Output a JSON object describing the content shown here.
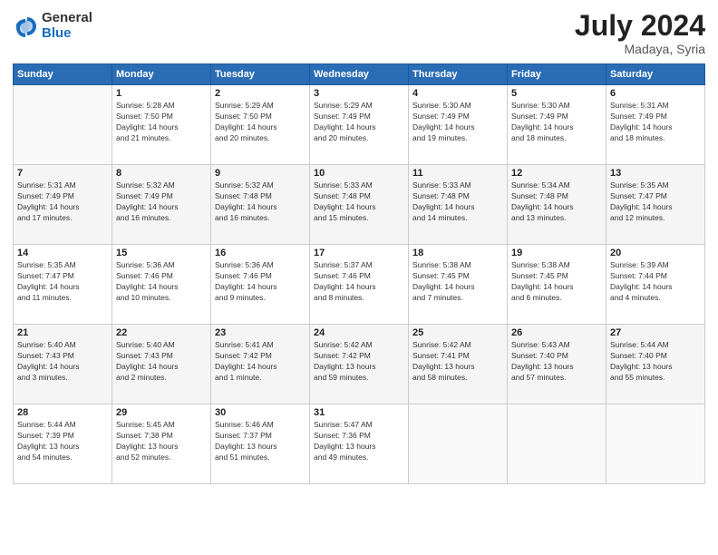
{
  "header": {
    "logo_general": "General",
    "logo_blue": "Blue",
    "month_year": "July 2024",
    "location": "Madaya, Syria"
  },
  "calendar": {
    "columns": [
      "Sunday",
      "Monday",
      "Tuesday",
      "Wednesday",
      "Thursday",
      "Friday",
      "Saturday"
    ],
    "rows": [
      [
        {
          "day": "",
          "info": ""
        },
        {
          "day": "1",
          "info": "Sunrise: 5:28 AM\nSunset: 7:50 PM\nDaylight: 14 hours\nand 21 minutes."
        },
        {
          "day": "2",
          "info": "Sunrise: 5:29 AM\nSunset: 7:50 PM\nDaylight: 14 hours\nand 20 minutes."
        },
        {
          "day": "3",
          "info": "Sunrise: 5:29 AM\nSunset: 7:49 PM\nDaylight: 14 hours\nand 20 minutes."
        },
        {
          "day": "4",
          "info": "Sunrise: 5:30 AM\nSunset: 7:49 PM\nDaylight: 14 hours\nand 19 minutes."
        },
        {
          "day": "5",
          "info": "Sunrise: 5:30 AM\nSunset: 7:49 PM\nDaylight: 14 hours\nand 18 minutes."
        },
        {
          "day": "6",
          "info": "Sunrise: 5:31 AM\nSunset: 7:49 PM\nDaylight: 14 hours\nand 18 minutes."
        }
      ],
      [
        {
          "day": "7",
          "info": "Sunrise: 5:31 AM\nSunset: 7:49 PM\nDaylight: 14 hours\nand 17 minutes."
        },
        {
          "day": "8",
          "info": "Sunrise: 5:32 AM\nSunset: 7:49 PM\nDaylight: 14 hours\nand 16 minutes."
        },
        {
          "day": "9",
          "info": "Sunrise: 5:32 AM\nSunset: 7:48 PM\nDaylight: 14 hours\nand 16 minutes."
        },
        {
          "day": "10",
          "info": "Sunrise: 5:33 AM\nSunset: 7:48 PM\nDaylight: 14 hours\nand 15 minutes."
        },
        {
          "day": "11",
          "info": "Sunrise: 5:33 AM\nSunset: 7:48 PM\nDaylight: 14 hours\nand 14 minutes."
        },
        {
          "day": "12",
          "info": "Sunrise: 5:34 AM\nSunset: 7:48 PM\nDaylight: 14 hours\nand 13 minutes."
        },
        {
          "day": "13",
          "info": "Sunrise: 5:35 AM\nSunset: 7:47 PM\nDaylight: 14 hours\nand 12 minutes."
        }
      ],
      [
        {
          "day": "14",
          "info": "Sunrise: 5:35 AM\nSunset: 7:47 PM\nDaylight: 14 hours\nand 11 minutes."
        },
        {
          "day": "15",
          "info": "Sunrise: 5:36 AM\nSunset: 7:46 PM\nDaylight: 14 hours\nand 10 minutes."
        },
        {
          "day": "16",
          "info": "Sunrise: 5:36 AM\nSunset: 7:46 PM\nDaylight: 14 hours\nand 9 minutes."
        },
        {
          "day": "17",
          "info": "Sunrise: 5:37 AM\nSunset: 7:46 PM\nDaylight: 14 hours\nand 8 minutes."
        },
        {
          "day": "18",
          "info": "Sunrise: 5:38 AM\nSunset: 7:45 PM\nDaylight: 14 hours\nand 7 minutes."
        },
        {
          "day": "19",
          "info": "Sunrise: 5:38 AM\nSunset: 7:45 PM\nDaylight: 14 hours\nand 6 minutes."
        },
        {
          "day": "20",
          "info": "Sunrise: 5:39 AM\nSunset: 7:44 PM\nDaylight: 14 hours\nand 4 minutes."
        }
      ],
      [
        {
          "day": "21",
          "info": "Sunrise: 5:40 AM\nSunset: 7:43 PM\nDaylight: 14 hours\nand 3 minutes."
        },
        {
          "day": "22",
          "info": "Sunrise: 5:40 AM\nSunset: 7:43 PM\nDaylight: 14 hours\nand 2 minutes."
        },
        {
          "day": "23",
          "info": "Sunrise: 5:41 AM\nSunset: 7:42 PM\nDaylight: 14 hours\nand 1 minute."
        },
        {
          "day": "24",
          "info": "Sunrise: 5:42 AM\nSunset: 7:42 PM\nDaylight: 13 hours\nand 59 minutes."
        },
        {
          "day": "25",
          "info": "Sunrise: 5:42 AM\nSunset: 7:41 PM\nDaylight: 13 hours\nand 58 minutes."
        },
        {
          "day": "26",
          "info": "Sunrise: 5:43 AM\nSunset: 7:40 PM\nDaylight: 13 hours\nand 57 minutes."
        },
        {
          "day": "27",
          "info": "Sunrise: 5:44 AM\nSunset: 7:40 PM\nDaylight: 13 hours\nand 55 minutes."
        }
      ],
      [
        {
          "day": "28",
          "info": "Sunrise: 5:44 AM\nSunset: 7:39 PM\nDaylight: 13 hours\nand 54 minutes."
        },
        {
          "day": "29",
          "info": "Sunrise: 5:45 AM\nSunset: 7:38 PM\nDaylight: 13 hours\nand 52 minutes."
        },
        {
          "day": "30",
          "info": "Sunrise: 5:46 AM\nSunset: 7:37 PM\nDaylight: 13 hours\nand 51 minutes."
        },
        {
          "day": "31",
          "info": "Sunrise: 5:47 AM\nSunset: 7:36 PM\nDaylight: 13 hours\nand 49 minutes."
        },
        {
          "day": "",
          "info": ""
        },
        {
          "day": "",
          "info": ""
        },
        {
          "day": "",
          "info": ""
        }
      ]
    ]
  }
}
